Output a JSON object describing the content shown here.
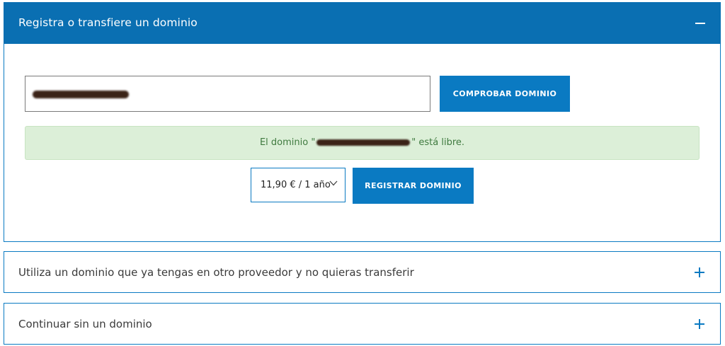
{
  "register_panel": {
    "title": "Registra o transfiere un dominio",
    "toggle_icon": "minus-icon",
    "domain_input": {
      "value": "",
      "placeholder": ""
    },
    "check_button_label": "COMPROBAR DOMINIO",
    "result_message": {
      "prefix": "El dominio \"",
      "suffix": "\" está libre."
    },
    "price_select": {
      "selected": "11,90 € / 1 año",
      "icon": "chevron-down-icon"
    },
    "register_button_label": "REGISTRAR DOMINIO"
  },
  "existing_domain_panel": {
    "title": "Utiliza un dominio que ya tengas en otro proveedor y no quieras transferir",
    "toggle_icon": "plus-icon"
  },
  "no_domain_panel": {
    "title": "Continuar sin un dominio",
    "toggle_icon": "plus-icon"
  },
  "colors": {
    "accent": "#0a7ac2",
    "header_bg": "#0a6fb2",
    "success_bg": "#dcefd8",
    "success_text": "#3f7a3f"
  }
}
